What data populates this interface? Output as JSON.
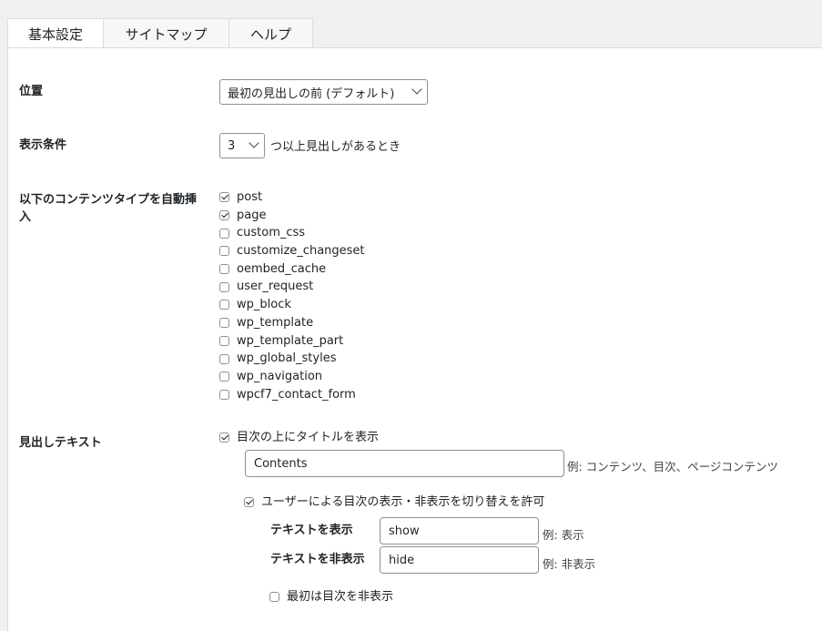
{
  "tabs": [
    {
      "label": "基本設定",
      "active": true
    },
    {
      "label": "サイトマップ",
      "active": false
    },
    {
      "label": "ヘルプ",
      "active": false
    }
  ],
  "position": {
    "label": "位置",
    "selected": "最初の見出しの前 (デフォルト)"
  },
  "display_condition": {
    "label": "表示条件",
    "selected": "3",
    "suffix": "つ以上見出しがあるとき"
  },
  "content_types": {
    "label": "以下のコンテンツタイプを自動挿入",
    "items": [
      {
        "label": "post",
        "checked": true
      },
      {
        "label": "page",
        "checked": true
      },
      {
        "label": "custom_css",
        "checked": false
      },
      {
        "label": "customize_changeset",
        "checked": false
      },
      {
        "label": "oembed_cache",
        "checked": false
      },
      {
        "label": "user_request",
        "checked": false
      },
      {
        "label": "wp_block",
        "checked": false
      },
      {
        "label": "wp_template",
        "checked": false
      },
      {
        "label": "wp_template_part",
        "checked": false
      },
      {
        "label": "wp_global_styles",
        "checked": false
      },
      {
        "label": "wp_navigation",
        "checked": false
      },
      {
        "label": "wpcf7_contact_form",
        "checked": false
      }
    ]
  },
  "heading_text": {
    "label": "見出しテキスト",
    "show_title": {
      "label": "目次の上にタイトルを表示",
      "checked": true
    },
    "title_value": "Contents",
    "title_hint": "例: コンテンツ、目次、ページコンテンツ",
    "allow_toggle": {
      "label": "ユーザーによる目次の表示・非表示を切り替えを許可",
      "checked": true
    },
    "show_text": {
      "label": "テキストを表示",
      "value": "show",
      "hint": "例: 表示"
    },
    "hide_text": {
      "label": "テキストを非表示",
      "value": "hide",
      "hint": "例: 非表示"
    },
    "hide_initially": {
      "label": "最初は目次を非表示",
      "checked": false
    }
  }
}
